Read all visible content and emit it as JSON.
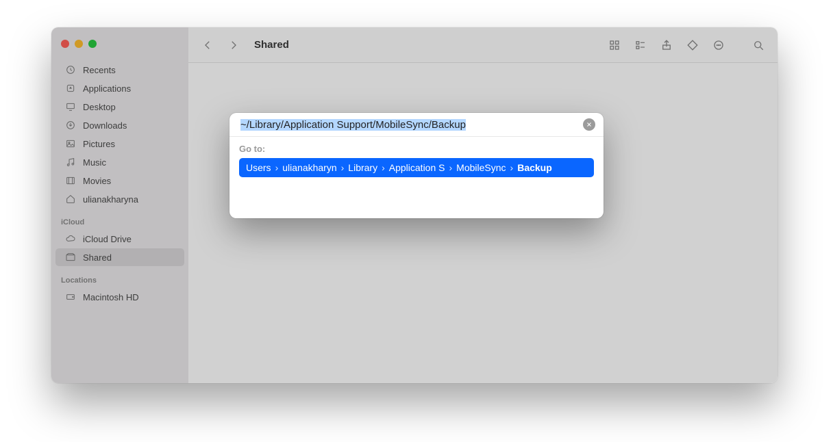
{
  "window": {
    "title": "Shared"
  },
  "sidebar": {
    "favorites": [
      {
        "name": "recents",
        "label": "Recents",
        "icon": "clock"
      },
      {
        "name": "applications",
        "label": "Applications",
        "icon": "app"
      },
      {
        "name": "desktop",
        "label": "Desktop",
        "icon": "desktop"
      },
      {
        "name": "downloads",
        "label": "Downloads",
        "icon": "download"
      },
      {
        "name": "pictures",
        "label": "Pictures",
        "icon": "image"
      },
      {
        "name": "music",
        "label": "Music",
        "icon": "music"
      },
      {
        "name": "movies",
        "label": "Movies",
        "icon": "film"
      },
      {
        "name": "home",
        "label": "ulianakharyna",
        "icon": "home"
      }
    ],
    "icloud_header": "iCloud",
    "icloud": [
      {
        "name": "icloud-drive",
        "label": "iCloud Drive",
        "icon": "cloud"
      },
      {
        "name": "shared",
        "label": "Shared",
        "icon": "shared",
        "active": true
      }
    ],
    "locations_header": "Locations",
    "locations": [
      {
        "name": "macintosh-hd",
        "label": "Macintosh HD",
        "icon": "disk"
      }
    ]
  },
  "goto": {
    "input_value": "~/Library/Application Support/MobileSync/Backup",
    "label": "Go to:",
    "crumbs": [
      {
        "label": "Users",
        "bold": false
      },
      {
        "label": "ulianakharyn",
        "bold": false
      },
      {
        "label": "Library",
        "bold": false
      },
      {
        "label": "Application S",
        "bold": false
      },
      {
        "label": "MobileSync",
        "bold": false
      },
      {
        "label": "Backup",
        "bold": true
      }
    ]
  }
}
